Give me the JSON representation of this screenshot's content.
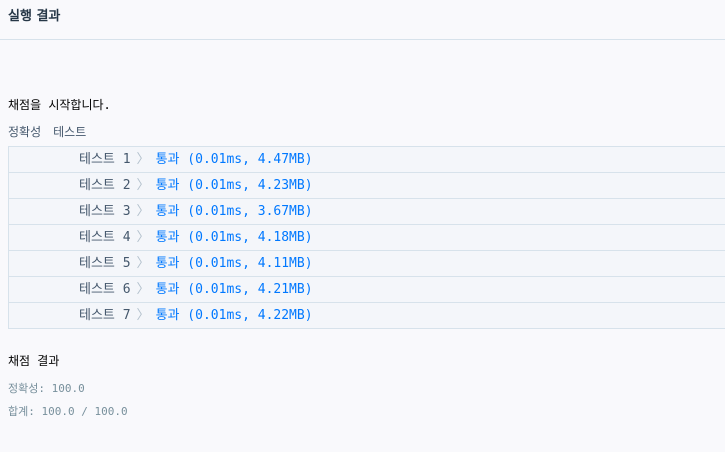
{
  "header": {
    "title": "실행 결과"
  },
  "output": {
    "start_message": "채점을 시작합니다.",
    "group_label": "정확성",
    "group_tab": "테스트",
    "tests": [
      {
        "name": "테스트 1",
        "result": "통과 (0.01ms, 4.47MB)"
      },
      {
        "name": "테스트 2",
        "result": "통과 (0.01ms, 4.23MB)"
      },
      {
        "name": "테스트 3",
        "result": "통과 (0.01ms, 3.67MB)"
      },
      {
        "name": "테스트 4",
        "result": "통과 (0.01ms, 4.18MB)"
      },
      {
        "name": "테스트 5",
        "result": "통과 (0.01ms, 4.11MB)"
      },
      {
        "name": "테스트 6",
        "result": "통과 (0.01ms, 4.21MB)"
      },
      {
        "name": "테스트 7",
        "result": "통과 (0.01ms, 4.22MB)"
      }
    ],
    "chevron": "〉",
    "grading_title": "채점 결과",
    "accuracy_line": "정확성: 100.0",
    "total_line": "합계: 100.0 / 100.0"
  },
  "colors": {
    "background": "#f9f9fc",
    "pass": "#0078ff",
    "border": "#d7e2eb"
  }
}
